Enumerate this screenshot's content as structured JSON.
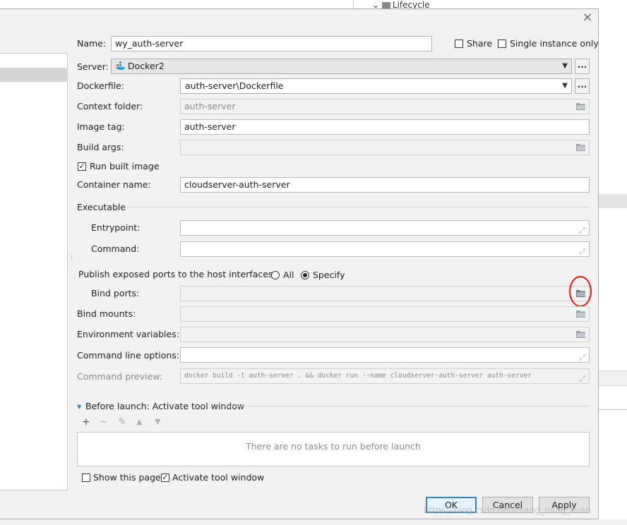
{
  "background": {
    "tree_item": "Lifecycle"
  },
  "dialog": {
    "close_glyph": "×",
    "name": {
      "label": "Name:",
      "value": "wy_auth-server"
    },
    "share": {
      "label": "Share",
      "checked": false
    },
    "single_instance": {
      "label": "Single instance only",
      "checked": false
    },
    "server": {
      "label": "Server:",
      "value": "Docker2",
      "more": "..."
    },
    "dockerfile": {
      "label": "Dockerfile:",
      "value": "auth-server\\Dockerfile",
      "more": "..."
    },
    "context_folder": {
      "label": "Context folder:",
      "value": "auth-server"
    },
    "image_tag": {
      "label": "Image tag:",
      "value": "auth-server"
    },
    "build_args": {
      "label": "Build args:",
      "value": ""
    },
    "run_built_image": {
      "label": "Run built image",
      "checked": true
    },
    "container_name": {
      "label": "Container name:",
      "value": "cloudserver-auth-server"
    },
    "executable": {
      "title": "Executable",
      "entrypoint": {
        "label": "Entrypoint:",
        "value": ""
      },
      "command": {
        "label": "Command:",
        "value": ""
      }
    },
    "publish_ports": {
      "label": "Publish exposed ports to the host interfaces:",
      "option_all": "All",
      "option_specify": "Specify",
      "selected": "Specify"
    },
    "bind_ports": {
      "label": "Bind ports:",
      "value": ""
    },
    "bind_mounts": {
      "label": "Bind mounts:",
      "value": ""
    },
    "env_vars": {
      "label": "Environment variables:",
      "value": ""
    },
    "cmd_options": {
      "label": "Command line options:",
      "value": ""
    },
    "cmd_preview": {
      "label": "Command preview:",
      "value": "docker build -t auth-server . && docker run --name cloudserver-auth-server auth-server"
    },
    "before_launch": {
      "title": "Before launch: Activate tool window",
      "empty_text": "There are no tasks to run before launch"
    },
    "show_page": {
      "label": "Show this page",
      "checked": false
    },
    "activate_tool": {
      "label": "Activate tool window",
      "checked": true
    },
    "buttons": {
      "ok": "OK",
      "cancel": "Cancel",
      "apply": "Apply"
    },
    "watermark": "https://blog.csdn.net/zhang_ming_xuan"
  },
  "colors": {
    "accent_blue": "#3c7fb1",
    "annotation_red": "#e01818",
    "docker_blue": "#2496ed"
  }
}
